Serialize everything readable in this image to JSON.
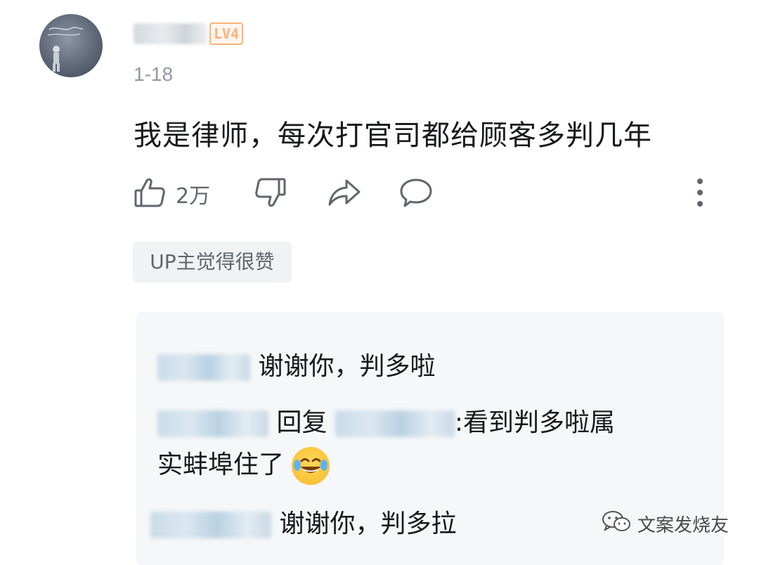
{
  "comment": {
    "user_level": "LV4",
    "date": "1-18",
    "text": "我是律师，每次打官司都给顾客多判几年",
    "like_count": "2万",
    "up_tag": "UP主觉得很赞"
  },
  "replies": [
    {
      "text": "谢谢你，判多啦"
    },
    {
      "reply_word": "回复",
      "text_line1": ":看到判多啦属",
      "text_line2": "实蚌埠住了"
    },
    {
      "text": "谢谢你，判多拉"
    }
  ],
  "icons": {
    "like": "thumbs-up-icon",
    "dislike": "thumbs-down-icon",
    "share": "share-icon",
    "reply": "comment-icon",
    "more": "more-vertical-icon",
    "emoji": "laughing-tears-emoji",
    "watermark": "wechat-icon"
  },
  "watermark": "文案发烧友",
  "colors": {
    "level_badge": "#ffb27a",
    "secondary_text": "#61666d",
    "reply_box_bg": "#f6f7f8"
  }
}
